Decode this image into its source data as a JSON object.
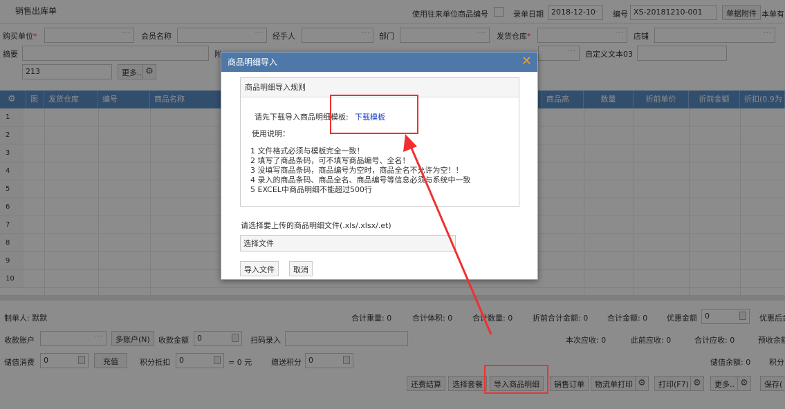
{
  "header": {
    "title": "销售出库单",
    "use_code_label": "使用往来单位商品编号",
    "date_label": "录单日期",
    "date_value": "2018-12-10",
    "number_label": "编号",
    "number_value": "XS-20181210-001",
    "attach_button": "单据附件",
    "extra_label": "本单有"
  },
  "form": {
    "buyer_label": "购买单位",
    "buyer_required": "*",
    "member_label": "会员名称",
    "handler_label": "经手人",
    "dept_label": "部门",
    "warehouse_label": "发货仓库",
    "warehouse_required": "*",
    "shop_label": "店铺",
    "summary_label": "摘要",
    "attach_partial": "附",
    "custom3_label": "自定义文本03",
    "row3_value": "213",
    "more_button": "更多..",
    "dots": "···"
  },
  "grid": {
    "columns": [
      "图",
      "发货仓库",
      "编号",
      "商品名称",
      "商品高",
      "数量",
      "折前单价",
      "折前金额",
      "折扣(0.9为"
    ],
    "rows": [
      "1",
      "2",
      "3",
      "4",
      "5",
      "6",
      "7",
      "8",
      "9",
      "10"
    ]
  },
  "footer": {
    "creator": "制单人: 默默",
    "totals": [
      "合计重量: 0",
      "合计体积: 0",
      "合计数量: 0",
      "折前合计金额: 0",
      "合计金额: 0"
    ],
    "discount_label": "优惠金额",
    "discount_value": "0",
    "after_discount": "优惠后金",
    "account_label": "收款账户",
    "multi_account": "多账户(N)",
    "receipt_label": "收款金额",
    "receipt_value": "0",
    "scan_label": "扫码录入",
    "receivable": [
      "本次应收: 0",
      "此前应收: 0",
      "合计应收: 0",
      "预收余额"
    ],
    "stored_label": "储值消费",
    "stored_value": "0",
    "recharge": "充值",
    "points_label": "积分抵扣",
    "points_value": "0",
    "points_eq": "= 0  元",
    "gift_label": "赠送积分",
    "gift_value": "0",
    "stored_balance": "储值余额: 0",
    "points_partial": "积分"
  },
  "actions": {
    "settle": "还费结算",
    "package": "选择套餐",
    "import": "导入商品明细",
    "order": "销售订单",
    "logistics": "物流单打印",
    "print": "打印(F7)",
    "more": "更多..",
    "save": "保存("
  },
  "modal": {
    "title": "商品明细导入",
    "close": "✕",
    "rules_title": "商品明细导入规则",
    "download_prompt": "请先下载导入商品明细模板:",
    "download_link": "下载模板",
    "usage_label": "使用说明：",
    "rules": [
      "1 文件格式必须与模板完全一致！",
      "2 填写了商品条码，可不填写商品编号、全名！",
      "3 没填写商品条码，商品编号为空时，商品全名不允许为空！！",
      "4 录入的商品条码、商品全名、商品编号等信息必须与系统中一致",
      "5 EXCEL中商品明细不能超过500行"
    ],
    "file_prompt": "请选择要上传的商品明细文件(.xls/.xlsx/.et)",
    "choose_file": "选择文件",
    "import_button": "导入文件",
    "cancel_button": "取消"
  },
  "colors": {
    "accent": "#5b8fc7",
    "modal_header": "#4d78a8",
    "annotation": "#f03030",
    "link": "#1a3fc9"
  }
}
